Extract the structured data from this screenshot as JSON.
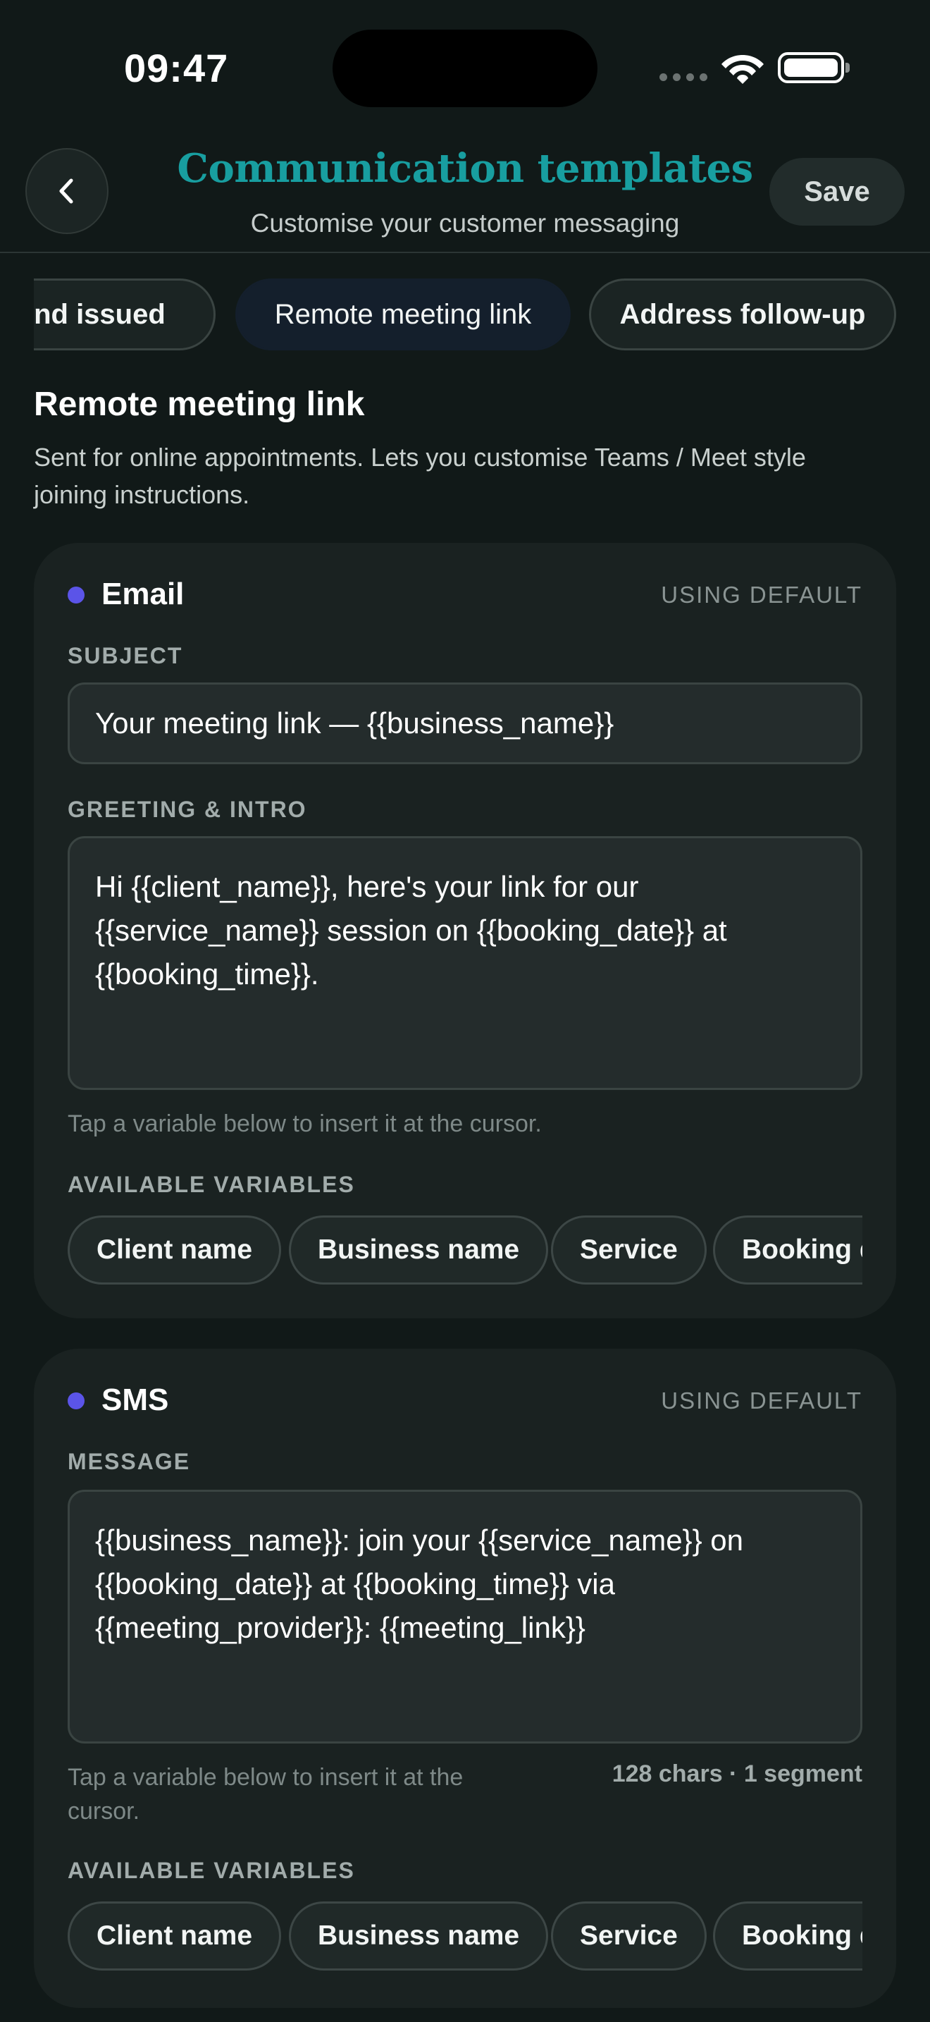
{
  "status_bar": {
    "time": "09:47"
  },
  "header": {
    "title": "Communication templates",
    "subtitle": "Customise your customer messaging",
    "save_label": "Save"
  },
  "tabs": [
    {
      "label": "Refund issued",
      "active": false
    },
    {
      "label": "Remote meeting link",
      "active": true
    },
    {
      "label": "Address follow-up",
      "active": false
    }
  ],
  "section": {
    "title": "Remote meeting link",
    "description": "Sent for online appointments. Lets you customise Teams / Meet style joining instructions."
  },
  "email": {
    "channel": "Email",
    "status": "USING DEFAULT",
    "subject_label": "SUBJECT",
    "subject_value": "Your meeting link — {{business_name}}",
    "greeting_label": "GREETING & INTRO",
    "greeting_value": "Hi {{client_name}}, here's your link for our {{service_name}} session on {{booking_date}} at {{booking_time}}.",
    "helper": "Tap a variable below to insert it at the cursor.",
    "variables_label": "AVAILABLE VARIABLES",
    "variables": [
      "Client name",
      "Business name",
      "Service",
      "Booking date"
    ]
  },
  "sms": {
    "channel": "SMS",
    "status": "USING DEFAULT",
    "message_label": "MESSAGE",
    "message_value": "{{business_name}}: join your {{service_name}} on {{booking_date}} at {{booking_time}} via {{meeting_provider}}: {{meeting_link}}",
    "helper": "Tap a variable below to insert it at the cursor.",
    "char_count": "128 chars · 1 segment",
    "variables_label": "AVAILABLE VARIABLES",
    "variables": [
      "Client name",
      "Business name",
      "Service",
      "Booking date"
    ]
  },
  "colors": {
    "background": "#111918",
    "card": "#1a2221",
    "accent_title": "#189ea0",
    "channel_dot": "#5b54e8",
    "active_tab": "#141f2c"
  }
}
